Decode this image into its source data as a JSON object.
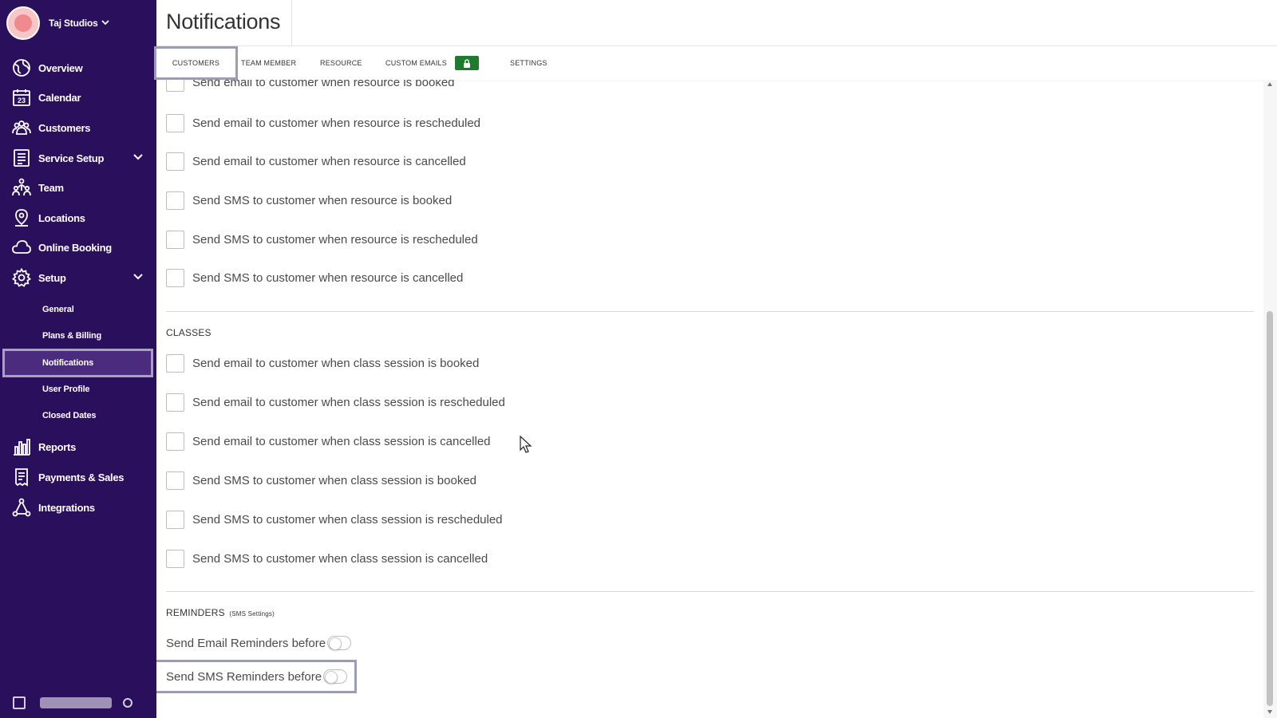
{
  "sidebar": {
    "brand": {
      "name": "Taj Studios"
    },
    "nav": [
      {
        "label": "Overview",
        "icon": "globe-icon"
      },
      {
        "label": "Calendar",
        "icon": "calendar-icon",
        "icon_text": "23"
      },
      {
        "label": "Customers",
        "icon": "users-icon"
      },
      {
        "label": "Service Setup",
        "icon": "list-icon",
        "expandable": true
      },
      {
        "label": "Team",
        "icon": "team-icon"
      },
      {
        "label": "Locations",
        "icon": "location-pin-icon"
      },
      {
        "label": "Online Booking",
        "icon": "cloud-icon"
      },
      {
        "label": "Setup",
        "icon": "gear-icon",
        "expandable": true
      }
    ],
    "setup_sub": [
      {
        "label": "General"
      },
      {
        "label": "Plans & Billing"
      },
      {
        "label": "Notifications",
        "active": true
      },
      {
        "label": "User Profile"
      },
      {
        "label": "Closed Dates"
      }
    ],
    "nav_bottom": [
      {
        "label": "Reports",
        "icon": "bar-chart-icon"
      },
      {
        "label": "Payments & Sales",
        "icon": "receipt-icon"
      },
      {
        "label": "Integrations",
        "icon": "integrations-icon"
      }
    ]
  },
  "header": {
    "title": "Notifications"
  },
  "tabs": [
    {
      "label": "CUSTOMERS",
      "active": true
    },
    {
      "label": "TEAM MEMBER"
    },
    {
      "label": "RESOURCE"
    },
    {
      "label": "CUSTOM EMAILS",
      "badge": "lock-icon"
    },
    {
      "label": "SETTINGS"
    }
  ],
  "resource_options": [
    "Send email to customer when resource is booked",
    "Send email to customer when resource is rescheduled",
    "Send email to customer when resource is cancelled",
    "Send SMS to customer when resource is booked",
    "Send SMS to customer when resource is rescheduled",
    "Send SMS to customer when resource is cancelled"
  ],
  "classes": {
    "heading": "CLASSES",
    "options": [
      "Send email to customer when class session is booked",
      "Send email to customer when class session is rescheduled",
      "Send email to customer when class session is cancelled",
      "Send SMS to customer when class session is booked",
      "Send SMS to customer when class session is rescheduled",
      "Send SMS to customer when class session is cancelled"
    ]
  },
  "reminders": {
    "heading": "REMINDERS",
    "subheading": "(SMS Settings)",
    "email_label": "Send Email Reminders before",
    "sms_label": "Send SMS Reminders before"
  },
  "colors": {
    "sidebar_bg": "#2a0f5c",
    "lock_badge": "#1f7a2e",
    "highlight": "#9c9cb4"
  }
}
